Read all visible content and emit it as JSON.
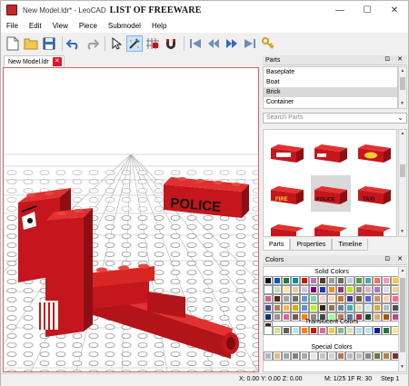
{
  "window": {
    "title": "New Model.ldr* - LeoCAD",
    "watermark": "LIST OF FREEWARE",
    "controls": {
      "minimize": "—",
      "maximize": "☐",
      "close": "✕"
    }
  },
  "menu": [
    "File",
    "Edit",
    "View",
    "Piece",
    "Submodel",
    "Help"
  ],
  "toolbar": {
    "icons": [
      "new-icon",
      "open-icon",
      "save-icon",
      "undo-icon",
      "redo-icon",
      "select-icon",
      "insert-icon",
      "snap-icon",
      "magnet-icon",
      "first-step-icon",
      "previous-step-icon",
      "next-step-icon",
      "last-step-icon",
      "key-icon"
    ]
  },
  "document_tab": {
    "label": "New Model.ldr",
    "close": "✕"
  },
  "viewport": {
    "brick_text": "POLICE",
    "colors": {
      "brick": "#c4161c",
      "background": "#ffffff",
      "grid": "#a0a0a0"
    }
  },
  "parts_panel": {
    "title": "Parts",
    "title_buttons": "⊡ ✕",
    "categories": [
      "Baseplate",
      "Boat",
      "Brick",
      "Container"
    ],
    "selected_category": "Brick",
    "search_placeholder": "Search Parts",
    "previews": [
      {
        "id": "p1",
        "label": ""
      },
      {
        "id": "p2",
        "label": ""
      },
      {
        "id": "p3",
        "label": ""
      },
      {
        "id": "p4",
        "label": "FIRE"
      },
      {
        "id": "p5",
        "label": "POLICE"
      },
      {
        "id": "p6",
        "label": "TAXI"
      }
    ],
    "tabs": [
      "Parts",
      "Properties",
      "Timeline"
    ],
    "selected_tab": "Parts"
  },
  "colors_panel": {
    "title": "Colors",
    "title_buttons": "⊡ ✕",
    "sections": [
      "Solid Colors",
      "Translucent Colors",
      "Special Colors"
    ],
    "solid": [
      "#05131d",
      "#0055bf",
      "#237841",
      "#008f9b",
      "#c91a09",
      "#c870a0",
      "#583927",
      "#9ba19d",
      "#6d6e5c",
      "#b4d2e3",
      "#4b9f4a",
      "#55a5af",
      "#f2705e",
      "#fc97ac",
      "#f2cd37",
      "#ffffff",
      "#c2dab8",
      "#fbe696",
      "#e4cd9e",
      "#c9cae2",
      "#81007b",
      "#2032b0",
      "#fe8a18",
      "#923978",
      "#bbe90b",
      "#958a73",
      "#e4adc8",
      "#ac78ba",
      "#e1d5ed",
      "#f3cf9b",
      "#cd6298",
      "#582a12",
      "#a0a5a9",
      "#6c6e68",
      "#5c9dd1",
      "#73dca1",
      "#fecccf",
      "#f6d7b3",
      "#cc702a",
      "#3f3691",
      "#7c503a",
      "#4c61db",
      "#d09168",
      "#feccb0",
      "#ff698f",
      "#4a469d",
      "#b48455",
      "#f8bb3d",
      "#dab000",
      "#5a93db",
      "#c0f500",
      "#352100",
      "#8d7452",
      "#70819a",
      "#36aebf",
      "#d9e4a7",
      "#cfe2f7",
      "#dbac34",
      "#adc3c0",
      "#4d4c52",
      "#0a3463",
      "#9c9291",
      "#df6695",
      "#6b5a5a",
      "#ff800d",
      "#898788",
      "#474747",
      "#99ff99",
      "#aa7d55",
      "#6074a1",
      "#b52952",
      "#184632",
      "#d6ac6f",
      "#a95500",
      "#aa4d8e",
      "#352100"
    ],
    "translucent": [
      "#fcfcfc",
      "#c9e788",
      "#635f52",
      "#aee9ef",
      "#ff800d",
      "#c91a09",
      "#df6695",
      "#f5cd2f",
      "#84b68d",
      "#d9e4a7",
      "#b3dbf6",
      "#aee9ef",
      "#0020a0",
      "#237841",
      "#fbe890",
      "#a5a5cb",
      "#e4adc8",
      "#e02a29",
      "#fe8a18",
      "#f08f1c",
      "#96709f",
      "#8320b7",
      "#5599c7",
      "#c0ff00",
      "#ce1d9b",
      "#68bcc5",
      "#ff800d",
      "#56e646"
    ],
    "special": [
      "#afb5c7",
      "#dcbc81",
      "#9ca3a8",
      "#808080",
      "#a5a9b4",
      "#e3e6ea",
      "#c3c3c3",
      "#d0d0d0",
      "#ae7a59",
      "#bbbdbc",
      "#c0c0c0",
      "#898788",
      "#6a7944",
      "#ac8247",
      "#7a2e3a",
      "#dfc176",
      "#505050",
      "#f5f3d7",
      "#a3a2a4",
      "#bc7d60",
      "#fffb00",
      "#e6e6e6",
      "#9b9b9b",
      "#6a6a6a",
      "#d0a060",
      "#c8c8c8",
      "#808890",
      "#606870",
      "#b08050",
      "#404040"
    ]
  },
  "status": {
    "coords": "X: 0.00 Y: 0.00 Z: 0.00",
    "model": "M: 1/25 1F R: 30",
    "step": "Step 1"
  }
}
